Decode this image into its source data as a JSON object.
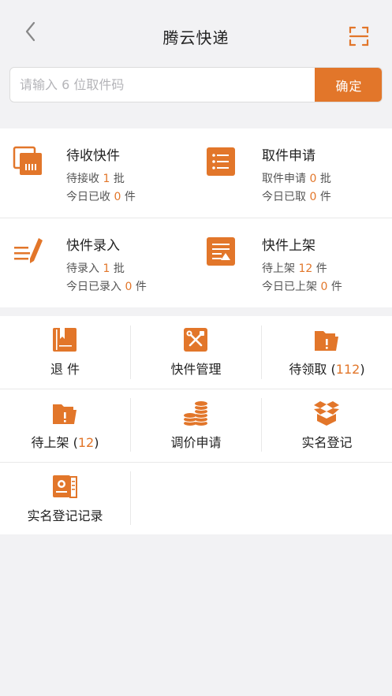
{
  "header": {
    "title": "腾云快递"
  },
  "search": {
    "placeholder": "请输入 6 位取件码",
    "confirm_label": "确定"
  },
  "stats": [
    {
      "title": "待收快件",
      "line1_pre": "待接收 ",
      "line1_num": "1",
      "line1_post": " 批",
      "line2_pre": "今日已收 ",
      "line2_num": "0",
      "line2_post": " 件",
      "icon": "package-icon"
    },
    {
      "title": "取件申请",
      "line1_pre": "取件申请 ",
      "line1_num": "0",
      "line1_post": " 批",
      "line2_pre": "今日已取 ",
      "line2_num": "0",
      "line2_post": " 件",
      "icon": "list-icon"
    },
    {
      "title": "快件录入",
      "line1_pre": "待录入 ",
      "line1_num": "1",
      "line1_post": " 批",
      "line2_pre": "今日已录入 ",
      "line2_num": "0",
      "line2_post": " 件",
      "icon": "pen-icon"
    },
    {
      "title": "快件上架",
      "line1_pre": "待上架 ",
      "line1_num": "12",
      "line1_post": " 件",
      "line2_pre": "今日已上架 ",
      "line2_num": "0",
      "line2_post": " 件",
      "icon": "shelf-icon"
    }
  ],
  "grid": [
    {
      "label": "退 件",
      "icon": "return-book-icon"
    },
    {
      "label": "快件管理",
      "icon": "tools-icon"
    },
    {
      "label_pre": "待领取 (",
      "count": "112",
      "label_post": ")",
      "icon": "folder-alert-icon"
    },
    {
      "label_pre": "待上架 (",
      "count": "12",
      "label_post": ")",
      "icon": "folder-alert-icon"
    },
    {
      "label": "调价申请",
      "icon": "coins-icon"
    },
    {
      "label": "实名登记",
      "icon": "open-box-icon"
    },
    {
      "label": "实名登记记录",
      "icon": "id-card-icon"
    }
  ],
  "colors": {
    "accent": "#e2762a",
    "background": "#f2f2f4"
  }
}
